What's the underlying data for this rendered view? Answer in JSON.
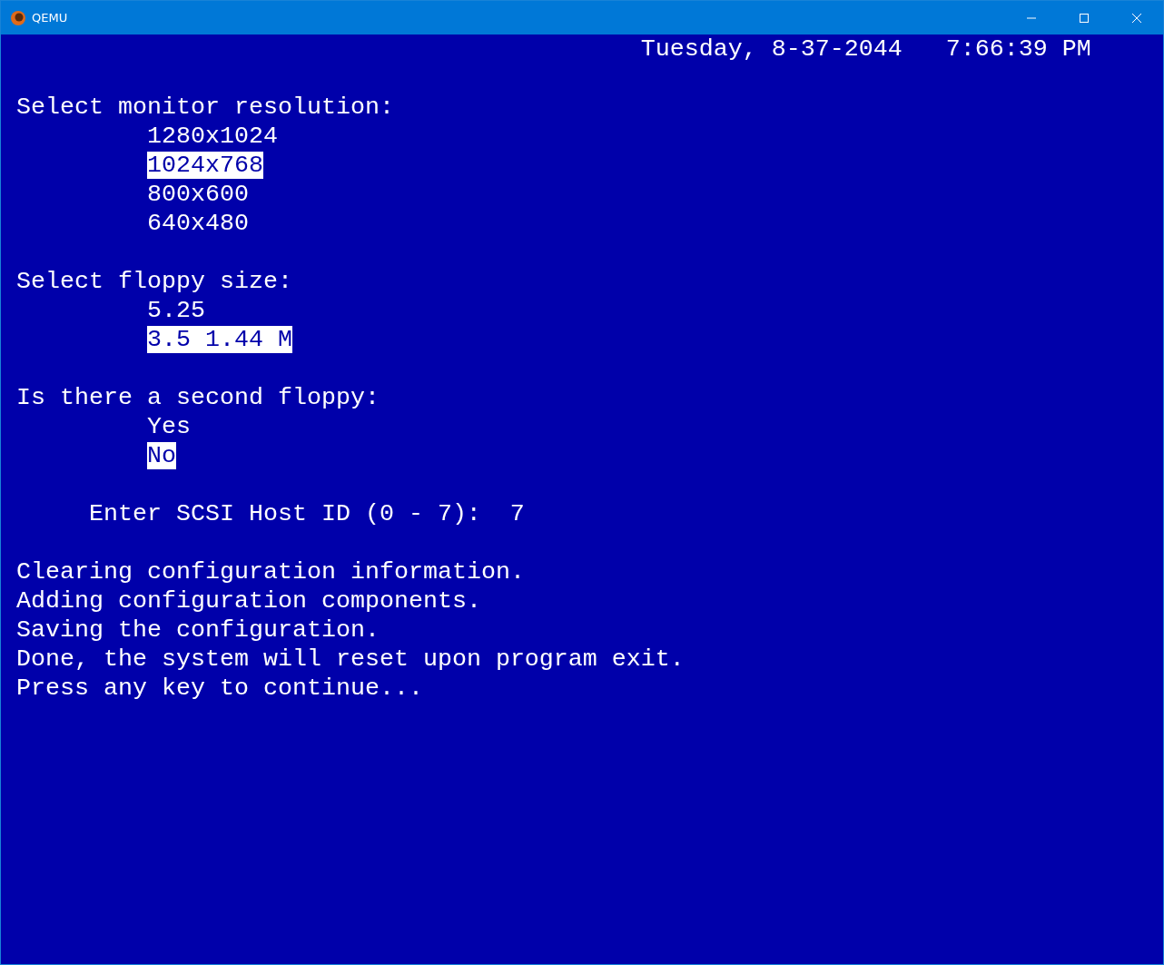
{
  "window": {
    "title": "QEMU"
  },
  "clock": {
    "date": "Tuesday, 8-37-2044",
    "time": "7:66:39 PM"
  },
  "questions": [
    {
      "prompt": "Select monitor resolution:",
      "options": [
        {
          "label": "1280x1024",
          "selected": false
        },
        {
          "label": "1024x768",
          "selected": true
        },
        {
          "label": "800x600",
          "selected": false
        },
        {
          "label": "640x480",
          "selected": false
        }
      ]
    },
    {
      "prompt": "Select floppy size:",
      "options": [
        {
          "label": "5.25",
          "selected": false
        },
        {
          "label": "3.5 1.44 M",
          "selected": true
        }
      ]
    },
    {
      "prompt": "Is there a second floppy:",
      "options": [
        {
          "label": "Yes",
          "selected": false
        },
        {
          "label": "No",
          "selected": true
        }
      ]
    }
  ],
  "scsi": {
    "prompt": "Enter SCSI Host ID (0 - 7):",
    "value": "7"
  },
  "messages": [
    "Clearing configuration information.",
    "Adding configuration components.",
    "Saving the configuration.",
    "Done, the system will reset upon program exit.",
    "Press any key to continue..."
  ]
}
